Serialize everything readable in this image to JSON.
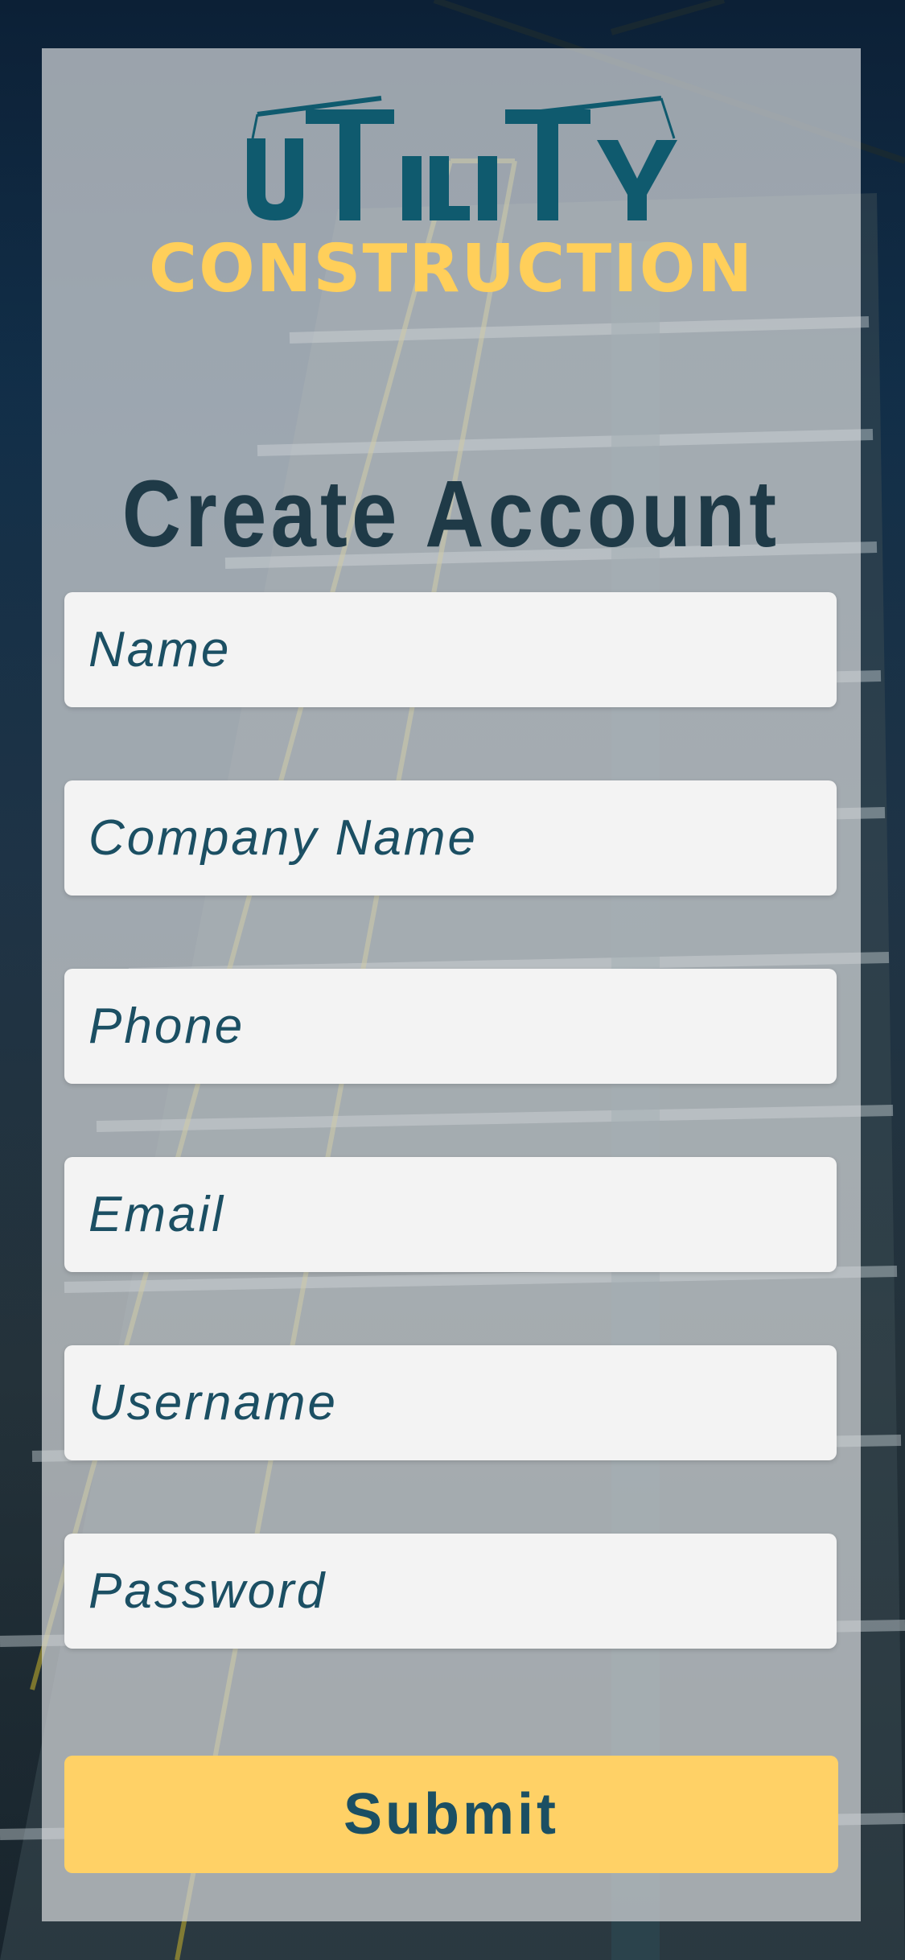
{
  "brand": {
    "logo_top": "UTILITY",
    "logo_bottom": "CONSTRUCTION",
    "primary_color": "#0f5a6e",
    "accent_color": "#ffcf5a"
  },
  "form": {
    "title": "Create Account",
    "fields": [
      {
        "name": "name",
        "placeholder": "Name"
      },
      {
        "name": "company",
        "placeholder": "Company Name"
      },
      {
        "name": "phone",
        "placeholder": "Phone"
      },
      {
        "name": "email",
        "placeholder": "Email"
      },
      {
        "name": "username",
        "placeholder": "Username"
      },
      {
        "name": "password",
        "placeholder": "Password"
      }
    ],
    "submit_label": "Submit"
  }
}
